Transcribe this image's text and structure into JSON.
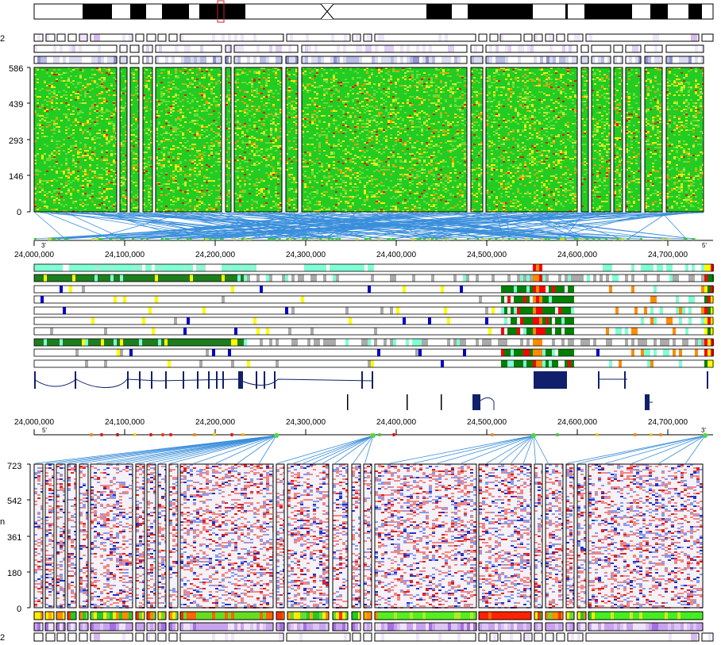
{
  "chromosome": {
    "left_labels": [
      "2",
      "2"
    ]
  },
  "top_heatmap": {
    "row_ticks": [
      "586",
      "439",
      "293",
      "146",
      "0"
    ],
    "left_clip_label": "",
    "colors": [
      "#22cc22",
      "#66dd33",
      "#c8e830",
      "#ffee00",
      "#ff9900",
      "#dd2200"
    ]
  },
  "genome_axis_top": {
    "ticks": [
      "24,000,000",
      "24,100,000",
      "24,200,000",
      "24,300,000",
      "24,400,000",
      "24,500,000",
      "24,600,000",
      "24,700,000"
    ],
    "strand_left": "3'",
    "strand_right": "5'"
  },
  "chromatin_tracks": {
    "colors": [
      "#1e7d1e",
      "#008000",
      "#7fffd4",
      "#ffff00",
      "#ff8c00",
      "#ff0000",
      "#aaaaaa",
      "#8a2be2",
      "#0000cd"
    ]
  },
  "genome_axis_bottom": {
    "ticks": [
      "24,000,000",
      "24,100,000",
      "24,200,000",
      "24,300,000",
      "24,400,000",
      "24,500,000",
      "24,600,000",
      "24,700,000"
    ],
    "strand_left": "5'",
    "strand_right": "3'"
  },
  "bottom_heatmap": {
    "row_ticks": [
      "723",
      "542",
      "361",
      "180",
      "0"
    ],
    "left_clip_label": "n",
    "colors": [
      "#2233cc",
      "#8899ee",
      "#f2f2fa",
      "#ee8888",
      "#dd2222"
    ]
  }
}
